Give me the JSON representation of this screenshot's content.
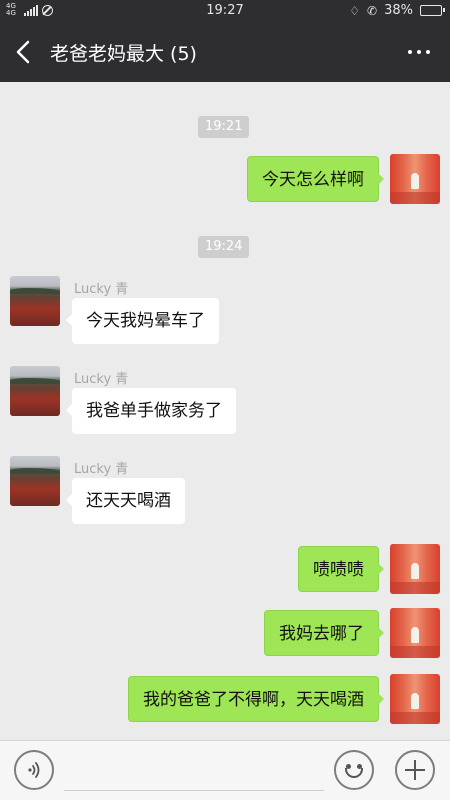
{
  "status_bar": {
    "network": "4G 4G",
    "time": "19:27",
    "battery": "38%",
    "battery_level": 0.38
  },
  "header": {
    "title": "老爸老妈最大 (5)"
  },
  "messages": [
    {
      "type": "time",
      "text": "19:21"
    },
    {
      "type": "outgoing",
      "text": "今天怎么样啊"
    },
    {
      "type": "time",
      "text": "19:24"
    },
    {
      "type": "incoming",
      "sender": "Lucky 青",
      "text": "今天我妈晕车了"
    },
    {
      "type": "incoming",
      "sender": "Lucky 青",
      "text": "我爸单手做家务了"
    },
    {
      "type": "incoming",
      "sender": "Lucky 青",
      "text": "还天天喝酒"
    },
    {
      "type": "outgoing",
      "text": "啧啧啧"
    },
    {
      "type": "outgoing",
      "text": "我妈去哪了"
    },
    {
      "type": "outgoing",
      "text": "我的爸爸了不得啊，天天喝酒"
    }
  ],
  "input_bar": {
    "value": "",
    "icons": [
      "voice-icon",
      "emoji-icon",
      "plus-icon"
    ]
  },
  "colors": {
    "nav_bg": "#2e2e30",
    "chat_bg": "#ebebeb",
    "outgoing_bubble": "#9ee655",
    "incoming_bubble": "#ffffff"
  }
}
